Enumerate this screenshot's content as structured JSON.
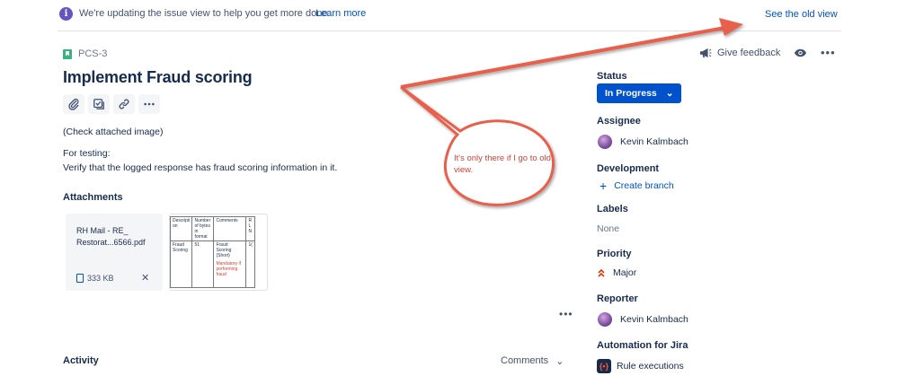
{
  "banner": {
    "icon": "info-icon",
    "text": "We're updating the issue view to help you get more done.",
    "link": "Learn more",
    "old_view_link": "See the old view"
  },
  "issue": {
    "key": "PCS-3",
    "title": "Implement Fraud scoring",
    "toolbar_icons": [
      "attach-icon",
      "subtask-icon",
      "link-icon",
      "more-icon"
    ],
    "description": {
      "line1": "(Check attached image)",
      "line2": "For testing:",
      "line3": "Verify that the logged response has fraud scoring information in it."
    }
  },
  "attachments": {
    "heading": "Attachments",
    "file": {
      "name": "RH Mail - RE_\nRestorat...6566.pdf",
      "size": "333 KB",
      "remove": "✕"
    },
    "thumbnail_table": {
      "headers": [
        "Descripti on",
        "Number of bytes in format",
        "Comments",
        "R L N"
      ],
      "row": [
        "Fraud Scoring",
        "51",
        "Fraud Scoring (Short)",
        "1("
      ],
      "note": "Mandatory if performing fraud"
    },
    "more": "•••"
  },
  "activity": {
    "heading": "Activity",
    "filter": "Comments",
    "filter_chevron": "⌄"
  },
  "header_actions": {
    "feedback": "Give feedback",
    "watch_icon": "eye-icon",
    "more": "•••"
  },
  "sidebar": {
    "status": {
      "label": "Status",
      "value": "In Progress",
      "chevron": "⌄"
    },
    "assignee": {
      "label": "Assignee",
      "name": "Kevin Kalmbach"
    },
    "development": {
      "label": "Development",
      "action": "Create branch",
      "plus": "+"
    },
    "labels": {
      "label": "Labels",
      "value": "None"
    },
    "priority": {
      "label": "Priority",
      "value": "Major"
    },
    "reporter": {
      "label": "Reporter",
      "name": "Kevin Kalmbach"
    },
    "automation": {
      "label": "Automation for Jira",
      "rule": "Rule executions",
      "rule_icon_text": "{•}"
    }
  },
  "annotation": {
    "text": "It's only there if I go to old view.",
    "color": "#e8604c"
  },
  "colors": {
    "primary": "#0052cc",
    "text": "#172b4d",
    "muted": "#6b778c",
    "banner_icon": "#6554c0",
    "story": "#36b37e",
    "priority_major": "#de350b"
  }
}
